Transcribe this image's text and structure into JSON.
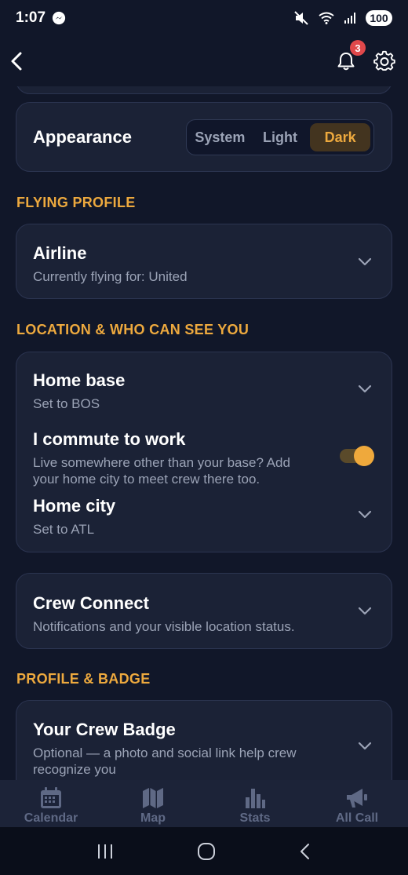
{
  "status_bar": {
    "time": "1:07",
    "battery": "100"
  },
  "header": {
    "notification_count": "3"
  },
  "appearance": {
    "label": "Appearance",
    "options": [
      "System",
      "Light",
      "Dark"
    ],
    "selected": "Dark"
  },
  "sections": {
    "flying_profile": "FLYING PROFILE",
    "location": "LOCATION & WHO CAN SEE YOU",
    "profile_badge": "PROFILE & BADGE"
  },
  "airline": {
    "title": "Airline",
    "subtitle": "Currently flying for: United"
  },
  "home_base": {
    "title": "Home base",
    "subtitle": "Set to BOS"
  },
  "commute": {
    "title": "I commute to work",
    "subtitle": "Live somewhere other than your base? Add your home city to meet crew there too.",
    "enabled": true
  },
  "home_city": {
    "title": "Home city",
    "subtitle": "Set to ATL"
  },
  "crew_connect": {
    "title": "Crew Connect",
    "subtitle": "Notifications and your visible location status."
  },
  "crew_badge": {
    "title": "Your Crew Badge",
    "subtitle": "Optional — a photo and social link help crew recognize you"
  },
  "bottom_nav": {
    "calendar": "Calendar",
    "map": "Map",
    "stats": "Stats",
    "all_call": "All Call"
  },
  "colors": {
    "background": "#111729",
    "card": "#1b2236",
    "accent": "#eda93e",
    "badge": "#e0484b"
  }
}
